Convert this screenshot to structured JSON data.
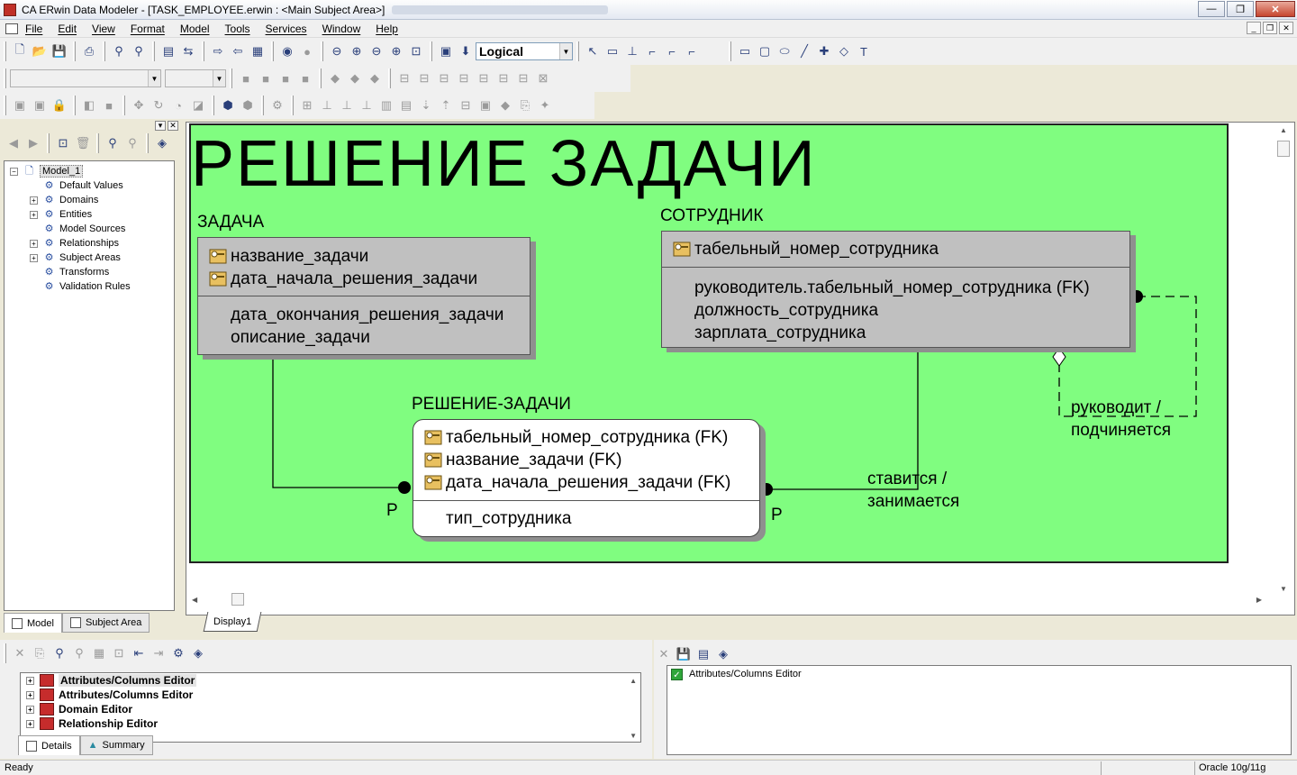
{
  "window": {
    "title": "CA ERwin Data Modeler - [TASK_EMPLOYEE.erwin : <Main Subject Area>]",
    "buttons": [
      "—",
      "❐",
      "✕"
    ]
  },
  "menu": [
    "File",
    "Edit",
    "View",
    "Format",
    "Model",
    "Tools",
    "Services",
    "Window",
    "Help"
  ],
  "toolbar": {
    "view_mode": "Logical"
  },
  "explorer": {
    "root": "Model_1",
    "items": [
      "Default Values",
      "Domains",
      "Entities",
      "Model Sources",
      "Relationships",
      "Subject Areas",
      "Transforms",
      "Validation Rules"
    ],
    "tabs": [
      "Model",
      "Subject Area"
    ]
  },
  "diagram": {
    "title": "РЕШЕНИЕ ЗАДАЧИ",
    "tab": "Display1",
    "background": "#80fd80",
    "entities": {
      "task": {
        "name": "ЗАДАЧА",
        "keys": [
          "название_задачи",
          "дата_начала_решения_задачи"
        ],
        "attrs": [
          "дата_окончания_решения_задачи",
          "описание_задачи"
        ]
      },
      "employee": {
        "name": "СОТРУДНИК",
        "keys": [
          "табельный_номер_сотрудника"
        ],
        "attrs": [
          "руководитель.табельный_номер_сотрудника (FK)",
          "должность_сотрудника",
          "зарплата_сотрудника"
        ]
      },
      "solution": {
        "name": "РЕШЕНИЕ-ЗАДАЧИ",
        "keys": [
          "табельный_номер_сотрудника (FK)",
          "название_задачи (FK)",
          "дата_начала_решения_задачи (FK)"
        ],
        "attrs": [
          "тип_сотрудника"
        ]
      }
    },
    "relationships": {
      "recursive_line1": "руководит /",
      "recursive_line2": "подчиняется",
      "emp_line1": "ставится /",
      "emp_line2": "занимается",
      "card_left": "P",
      "card_right": "P"
    }
  },
  "bottom_left": {
    "rows": [
      "Attributes/Columns Editor",
      "Attributes/Columns Editor",
      "Domain Editor",
      "Relationship Editor"
    ],
    "tabs": [
      "Details",
      "Summary"
    ]
  },
  "bottom_right": {
    "rows": [
      "Attributes/Columns Editor"
    ]
  },
  "status": {
    "text": "Ready",
    "db": "Oracle 10g/11g"
  }
}
